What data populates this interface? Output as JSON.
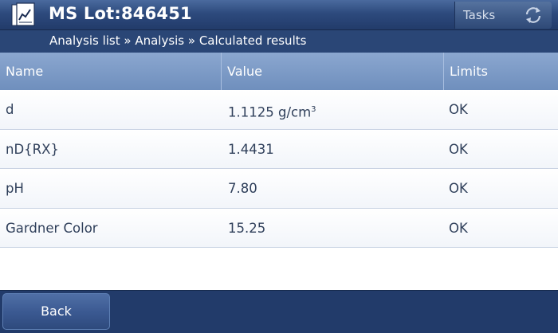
{
  "header": {
    "title": "MS Lot:846451",
    "tasks_label": "Tasks"
  },
  "breadcrumb": "Analysis list » Analysis » Calculated results",
  "table": {
    "columns": [
      "Name",
      "Value",
      "Limits"
    ],
    "rows": [
      {
        "name": "d",
        "value": "1.1125 g/cm",
        "value_sup": "3",
        "limits": "OK"
      },
      {
        "name": "nD{RX}",
        "value": "1.4431",
        "value_sup": "",
        "limits": "OK"
      },
      {
        "name": "pH",
        "value": "7.80",
        "value_sup": "",
        "limits": "OK"
      },
      {
        "name": "Gardner Color",
        "value": "15.25",
        "value_sup": "",
        "limits": "OK"
      }
    ]
  },
  "footer": {
    "back_label": "Back"
  },
  "icons": {
    "header_icon": "document-chart-icon",
    "tasks_icon": "refresh-icon"
  }
}
